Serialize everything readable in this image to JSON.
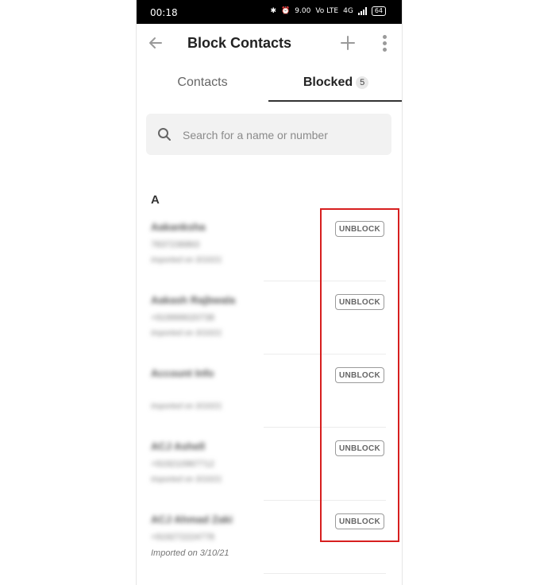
{
  "status_bar": {
    "time": "00:18",
    "network_speed": "9.00",
    "network_type": "Vo LTE",
    "network_type2": "4G",
    "battery": "64"
  },
  "app_bar": {
    "title": "Block Contacts"
  },
  "tabs": [
    {
      "label": "Contacts"
    },
    {
      "label": "Blocked",
      "badge": "5"
    }
  ],
  "search": {
    "placeholder": "Search for a name or number"
  },
  "section_header": "A",
  "contacts": [
    {
      "name": "Aakanksha",
      "phone": "7837236863",
      "imported": "Imported on 3/10/21",
      "action": "UNBLOCK"
    },
    {
      "name": "Aakash Rajbwala",
      "phone": "+919999020738",
      "imported": "Imported on 3/10/21",
      "action": "UNBLOCK"
    },
    {
      "name": "Account Info",
      "phone": "",
      "imported": "Imported on 3/10/21",
      "action": "UNBLOCK"
    },
    {
      "name": "ACJ Ashell",
      "phone": "+919210967712",
      "imported": "Imported on 3/10/21",
      "action": "UNBLOCK"
    },
    {
      "name": "ACJ Ahmad Zaki",
      "phone": "+919272224778",
      "imported": "Imported on 3/10/21",
      "action": "UNBLOCK"
    }
  ],
  "colors": {
    "highlight": "#d71f1f",
    "tab_underline": "#333333",
    "search_bg": "#f2f2f2"
  }
}
